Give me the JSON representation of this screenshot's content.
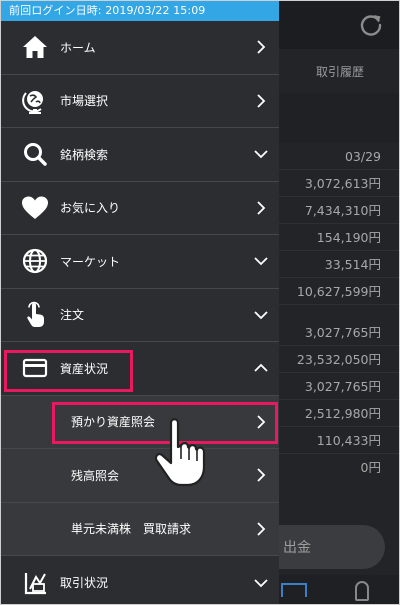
{
  "login_bar": {
    "text": "前回ログイン日時: 2019/03/22 15:09"
  },
  "background": {
    "tab_label": "取引履歴",
    "date": "03/29",
    "values": [
      "3,072,613円",
      "7,434,310円",
      "154,190円",
      "33,514円",
      "10,627,599円",
      "3,027,765円",
      "23,532,050円",
      "3,027,765円",
      "2,512,980円",
      "110,433円",
      "0円"
    ],
    "button_label": "出金"
  },
  "menu": {
    "items": [
      {
        "label": "ホーム",
        "icon": "home-icon",
        "arrow": "right"
      },
      {
        "label": "市場選択",
        "icon": "globe-stand-icon",
        "arrow": "right"
      },
      {
        "label": "銘柄検索",
        "icon": "search-icon",
        "arrow": "down"
      },
      {
        "label": "お気に入り",
        "icon": "heart-icon",
        "arrow": "right"
      },
      {
        "label": "マーケット",
        "icon": "globe-icon",
        "arrow": "down"
      },
      {
        "label": "注文",
        "icon": "tap-hand-icon",
        "arrow": "down"
      },
      {
        "label": "資産状況",
        "icon": "card-icon",
        "arrow": "up"
      }
    ],
    "sub_items": [
      {
        "label": "預かり資産照会",
        "arrow": "right"
      },
      {
        "label": "残高照会",
        "arrow": "right"
      },
      {
        "label": "単元未満株　買取請求",
        "arrow": "right"
      }
    ],
    "last_item": {
      "label": "取引状況",
      "icon": "chart-note-icon",
      "arrow": "down"
    }
  },
  "colors": {
    "accent_bar": "#33a6e5",
    "highlight": "#e8195f",
    "drawer_bg": "#2b2d30",
    "sub_bg": "#37393c"
  }
}
